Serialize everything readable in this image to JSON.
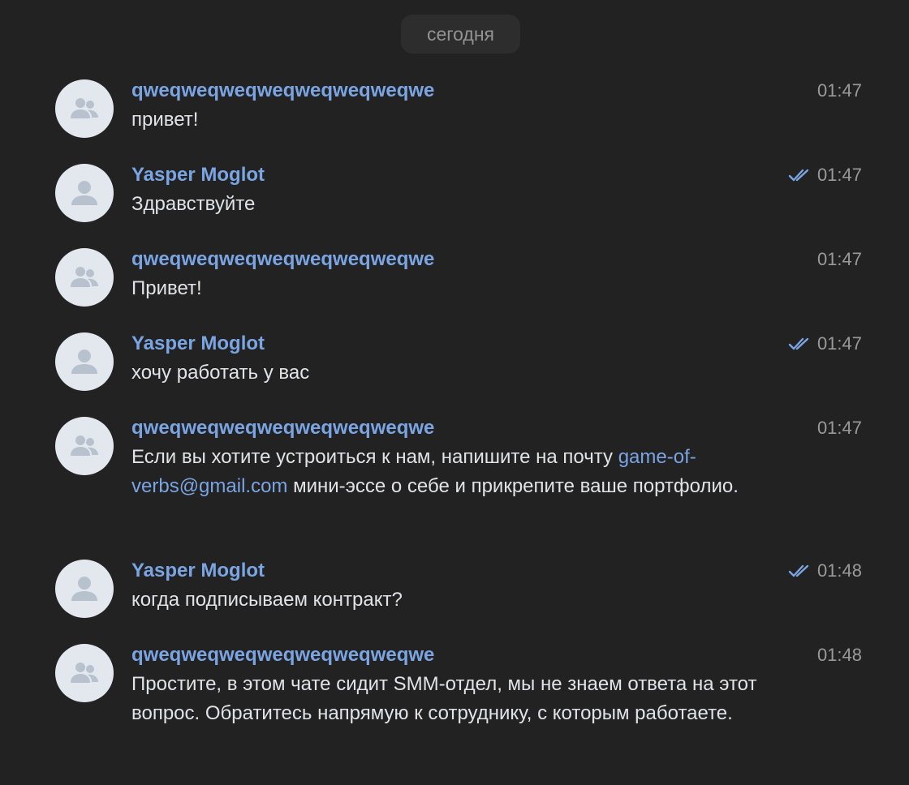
{
  "date_separator": "сегодня",
  "colors": {
    "background": "#222222",
    "author": "#7aa4e2",
    "text": "#e1e3e6",
    "time": "#9a9a9a",
    "link": "#7aa4e2"
  },
  "messages": [
    {
      "author": "qweqweqweqweqweqweqweqwe",
      "avatar_icon": "group-icon",
      "time": "01:47",
      "read": false,
      "text": "привет!"
    },
    {
      "author": "Yasper Moglot",
      "avatar_icon": "user-icon",
      "time": "01:47",
      "read": true,
      "text": "Здравствуйте"
    },
    {
      "author": "qweqweqweqweqweqweqweqwe",
      "avatar_icon": "group-icon",
      "time": "01:47",
      "read": false,
      "text": "Привет!"
    },
    {
      "author": "Yasper Moglot",
      "avatar_icon": "user-icon",
      "time": "01:47",
      "read": true,
      "text": "хочу работать у вас"
    },
    {
      "author": "qweqweqweqweqweqweqweqwe",
      "avatar_icon": "group-icon",
      "time": "01:47",
      "read": false,
      "text_before": "Если вы хотите устроиться к нам, напишите на почту ",
      "link": "game-of-verbs@gmail.com",
      "text_after": " мини-эссе о себе и прикрепите ваше портфолио."
    },
    {
      "author": "Yasper Moglot",
      "avatar_icon": "user-icon",
      "time": "01:48",
      "read": true,
      "text": "когда подписываем контракт?"
    },
    {
      "author": "qweqweqweqweqweqweqweqwe",
      "avatar_icon": "group-icon",
      "time": "01:48",
      "read": false,
      "text": "Простите, в этом чате сидит SMM-отдел, мы не знаем ответа на этот вопрос. Обратитесь напрямую к сотруднику, с которым работаете."
    }
  ]
}
